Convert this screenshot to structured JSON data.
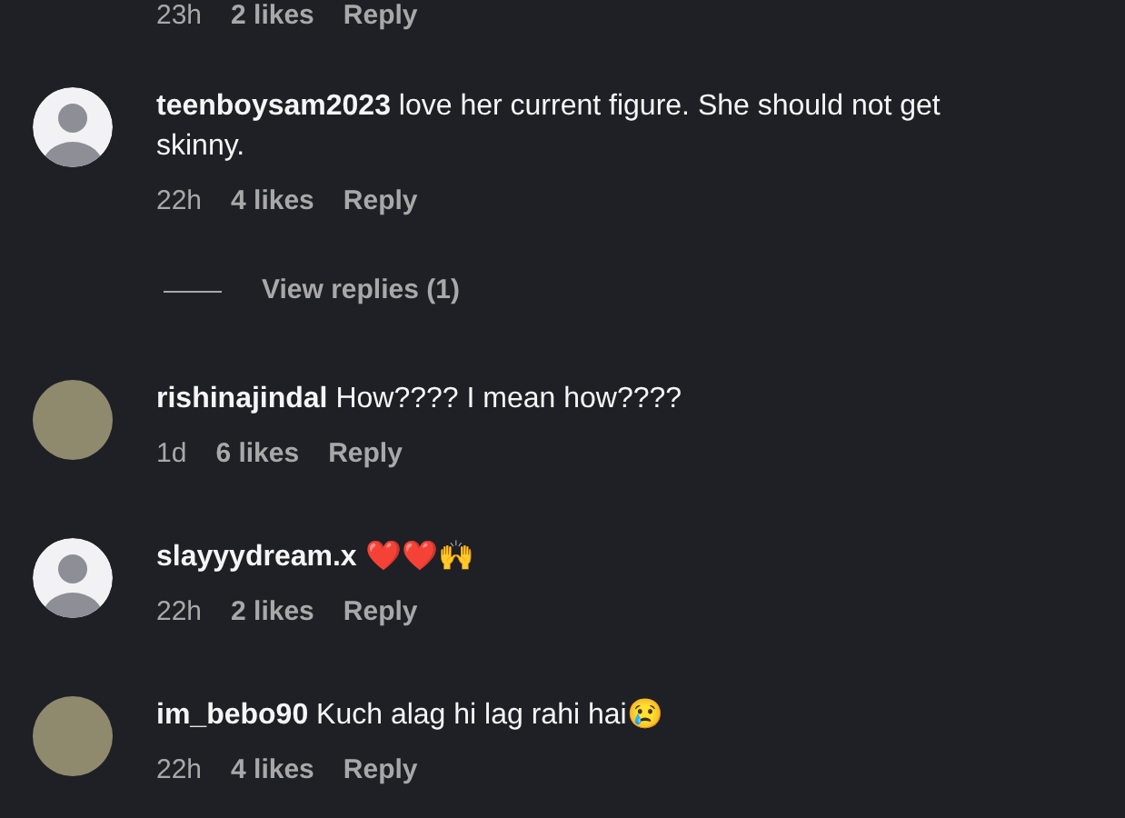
{
  "top_meta": {
    "time": "23h",
    "likes": "2 likes",
    "reply": "Reply"
  },
  "comments": [
    {
      "username": "teenboysam2023",
      "text": "love her current figure. She should not get skinny.",
      "has_photo": false,
      "time": "22h",
      "likes": "4 likes",
      "reply": "Reply",
      "view_replies": "View replies (1)"
    },
    {
      "username": "rishinajindal",
      "text": "How???? I mean how????",
      "has_photo": true,
      "time": "1d",
      "likes": "6 likes",
      "reply": "Reply"
    },
    {
      "username": "slayyydream.x",
      "text": "❤️❤️🙌",
      "has_photo": false,
      "time": "22h",
      "likes": "2 likes",
      "reply": "Reply"
    },
    {
      "username": "im_bebo90",
      "text": "Kuch alag hi lag rahi hai😢",
      "has_photo": true,
      "time": "22h",
      "likes": "4 likes",
      "reply": "Reply"
    }
  ]
}
